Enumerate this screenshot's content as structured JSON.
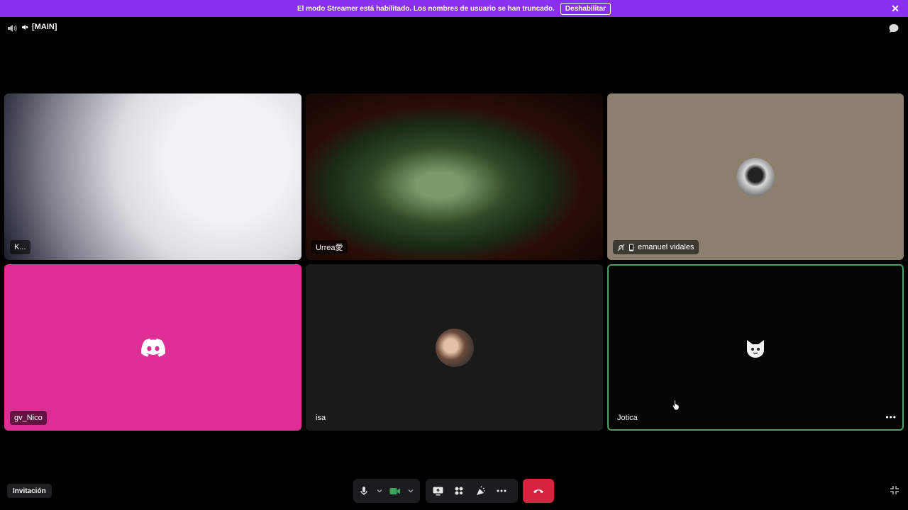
{
  "banner": {
    "message": "El modo Streamer está habilitado. Los nombres de usuario se han truncado.",
    "disable_label": "Deshabilitar",
    "color": "#8b2ff0"
  },
  "header": {
    "channel_name": "[MAIN]"
  },
  "tiles": [
    {
      "name": "K...",
      "type": "video"
    },
    {
      "name": "Urrea愛",
      "type": "video"
    },
    {
      "name": "emanuel vidales",
      "type": "avatar",
      "muted": true,
      "mobile": true
    },
    {
      "name": "gv_Nico",
      "type": "default-avatar",
      "color": "#dd2e96"
    },
    {
      "name": "isa",
      "type": "avatar"
    },
    {
      "name": "Jotica",
      "type": "avatar",
      "speaking": true
    }
  ],
  "footer": {
    "invite_label": "Invitación"
  },
  "colors": {
    "hangup": "#d7243e",
    "speaking_border": "#4fa062",
    "camera_active": "#3ba55d"
  }
}
